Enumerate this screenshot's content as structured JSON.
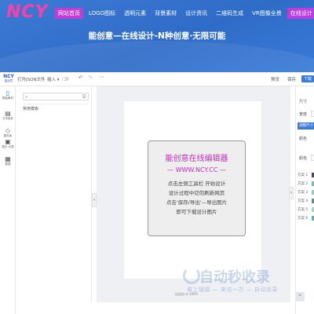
{
  "site": {
    "logo": "NCY",
    "nav": [
      {
        "label": "网站首页",
        "active": true
      },
      {
        "label": "LOGO图标"
      },
      {
        "label": "透明元素"
      },
      {
        "label": "背景素材"
      },
      {
        "label": "设计资讯"
      },
      {
        "label": "二维码生成"
      },
      {
        "label": "VR图像全景"
      },
      {
        "label": "在线设计",
        "accent": true
      }
    ],
    "hero_title": "能创意—在线设计-N种创意·无限可能"
  },
  "editor": {
    "logo_line1": "NCY",
    "logo_line2": "能创意",
    "toolbar": {
      "open_json": "打开JSON文件",
      "insert": "插入",
      "preview": "预览",
      "save": "保存",
      "download": "下载"
    },
    "rail": [
      {
        "label": "模板素材",
        "icon": "template-icon",
        "active": true
      },
      {
        "label": "文本组件",
        "icon": "text-icon"
      },
      {
        "label": "图标库",
        "icon": "icon-library-icon"
      },
      {
        "label": "图片·水透",
        "icon": "image-icon"
      },
      {
        "label": "数据",
        "icon": "data-icon"
      }
    ],
    "left_panel": {
      "search_placeholder": "",
      "section_label": "常用模板"
    },
    "canvas": {
      "card_title": "能创意在线编辑器",
      "card_url": "— WWW.NCY.CC —",
      "lines": [
        "点击左侧工具栏 开始设计",
        "设计过程中切勿刷新网页",
        "点击'保存/导出'—导出图片",
        "即可下载设计图片"
      ],
      "status": "自适应 ⊞ 100%"
    },
    "right_panel": {
      "size_label": "尺寸",
      "width_label": "宽度",
      "adjust_button": "调整尺寸",
      "color_label": "颜色",
      "color_sub": "颜色",
      "schemes": [
        {
          "label": "方案 1",
          "color": "#5b3a7a"
        },
        {
          "label": "方案 2",
          "color": "#5ec7c1"
        },
        {
          "label": "方案 3",
          "color": "#7fd3d0"
        },
        {
          "label": "方案 4",
          "color": "#3d9e9a"
        },
        {
          "label": "方案 5",
          "color": "#8fded8"
        },
        {
          "label": "方案 6",
          "color": "#4cb9b3"
        }
      ]
    }
  },
  "watermark": {
    "main": "自动秒收录",
    "sub": "做上链接 — 来访一次 — 自动收录"
  },
  "colors": {
    "hero_bg": "#3a78d6",
    "logo": "#ff3ea8",
    "nav_active": "#c13dd6",
    "accent_blue": "#3c78d8",
    "card_text": "#c02ebd"
  }
}
